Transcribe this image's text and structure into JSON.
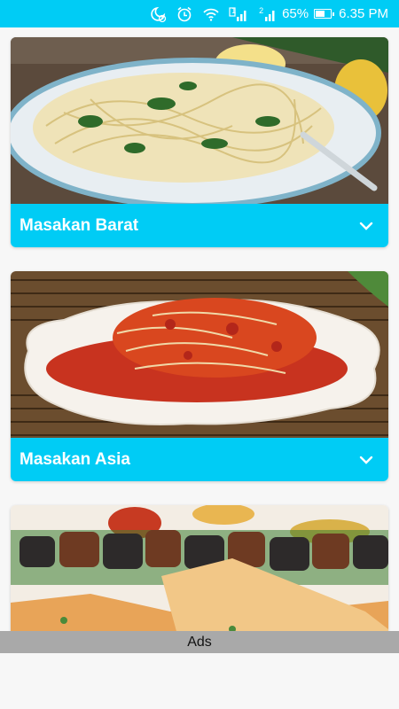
{
  "status_bar": {
    "battery_percent": "65%",
    "battery_level": 0.65,
    "time": "6.35 PM",
    "sim1_label": "1",
    "sim2_label": "2",
    "icons": [
      "moon-clock-icon",
      "alarm-icon",
      "wifi-icon",
      "signal-sim1-icon",
      "signal-sim2-icon",
      "battery-icon"
    ]
  },
  "cards": [
    {
      "title": "Masakan Barat",
      "image": "pasta-plate-photo",
      "icon": "chevron-down-icon"
    },
    {
      "title": "Masakan Asia",
      "image": "kimchi-plate-photo",
      "icon": "chevron-down-icon"
    },
    {
      "title": "",
      "image": "kebab-platter-photo"
    }
  ],
  "ads": {
    "label": "Ads"
  },
  "colors": {
    "accent": "#00ccf5",
    "ads_bar": "#a9a9a9",
    "background": "#f7f7f7"
  }
}
